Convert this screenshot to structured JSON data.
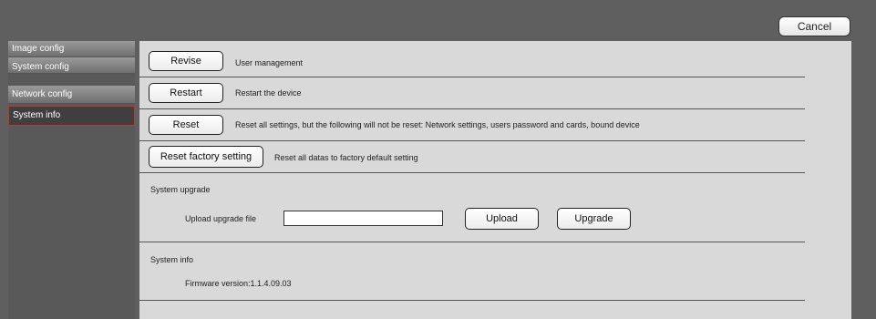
{
  "header": {
    "cancel_label": "Cancel"
  },
  "sidebar": {
    "items": [
      {
        "label": "Image config"
      },
      {
        "label": "System config"
      },
      {
        "label": "Network config"
      },
      {
        "label": "System info"
      }
    ]
  },
  "main": {
    "revise": {
      "button": "Revise",
      "desc": "User management"
    },
    "restart": {
      "button": "Restart",
      "desc": "Restart the device"
    },
    "reset": {
      "button": "Reset",
      "desc": "Reset all settings, but the following will not be reset: Network settings, users password and cards, bound device"
    },
    "factory": {
      "button": "Reset factory setting",
      "desc": "Reset all datas to factory default setting"
    },
    "upgrade": {
      "title": "System upgrade",
      "file_label": "Upload upgrade file",
      "file_value": "",
      "upload_button": "Upload",
      "upgrade_button": "Upgrade"
    },
    "info": {
      "title": "System info",
      "firmware": "Firmware version:1.1.4.09.03"
    }
  }
}
